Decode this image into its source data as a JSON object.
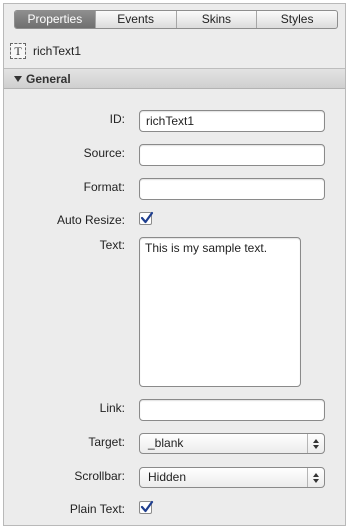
{
  "tabs": [
    {
      "label": "Properties",
      "active": true
    },
    {
      "label": "Events",
      "active": false
    },
    {
      "label": "Skins",
      "active": false
    },
    {
      "label": "Styles",
      "active": false
    }
  ],
  "component": {
    "icon": "text-component-icon",
    "icon_glyph": "T",
    "name": "richText1"
  },
  "section": {
    "title": "General"
  },
  "fields": {
    "id": {
      "label": "ID:",
      "value": "richText1"
    },
    "source": {
      "label": "Source:",
      "value": ""
    },
    "format": {
      "label": "Format:",
      "value": ""
    },
    "auto_resize": {
      "label": "Auto Resize:",
      "checked": true
    },
    "text": {
      "label": "Text:",
      "value": "This is my sample text."
    },
    "link": {
      "label": "Link:",
      "value": ""
    },
    "target": {
      "label": "Target:",
      "value": "_blank"
    },
    "scrollbar": {
      "label": "Scrollbar:",
      "value": "Hidden"
    },
    "plain_text": {
      "label": "Plain Text:",
      "checked": true
    }
  },
  "colors": {
    "checkmark": "#1f3f8f",
    "active_tab": "#7a7a7a"
  }
}
